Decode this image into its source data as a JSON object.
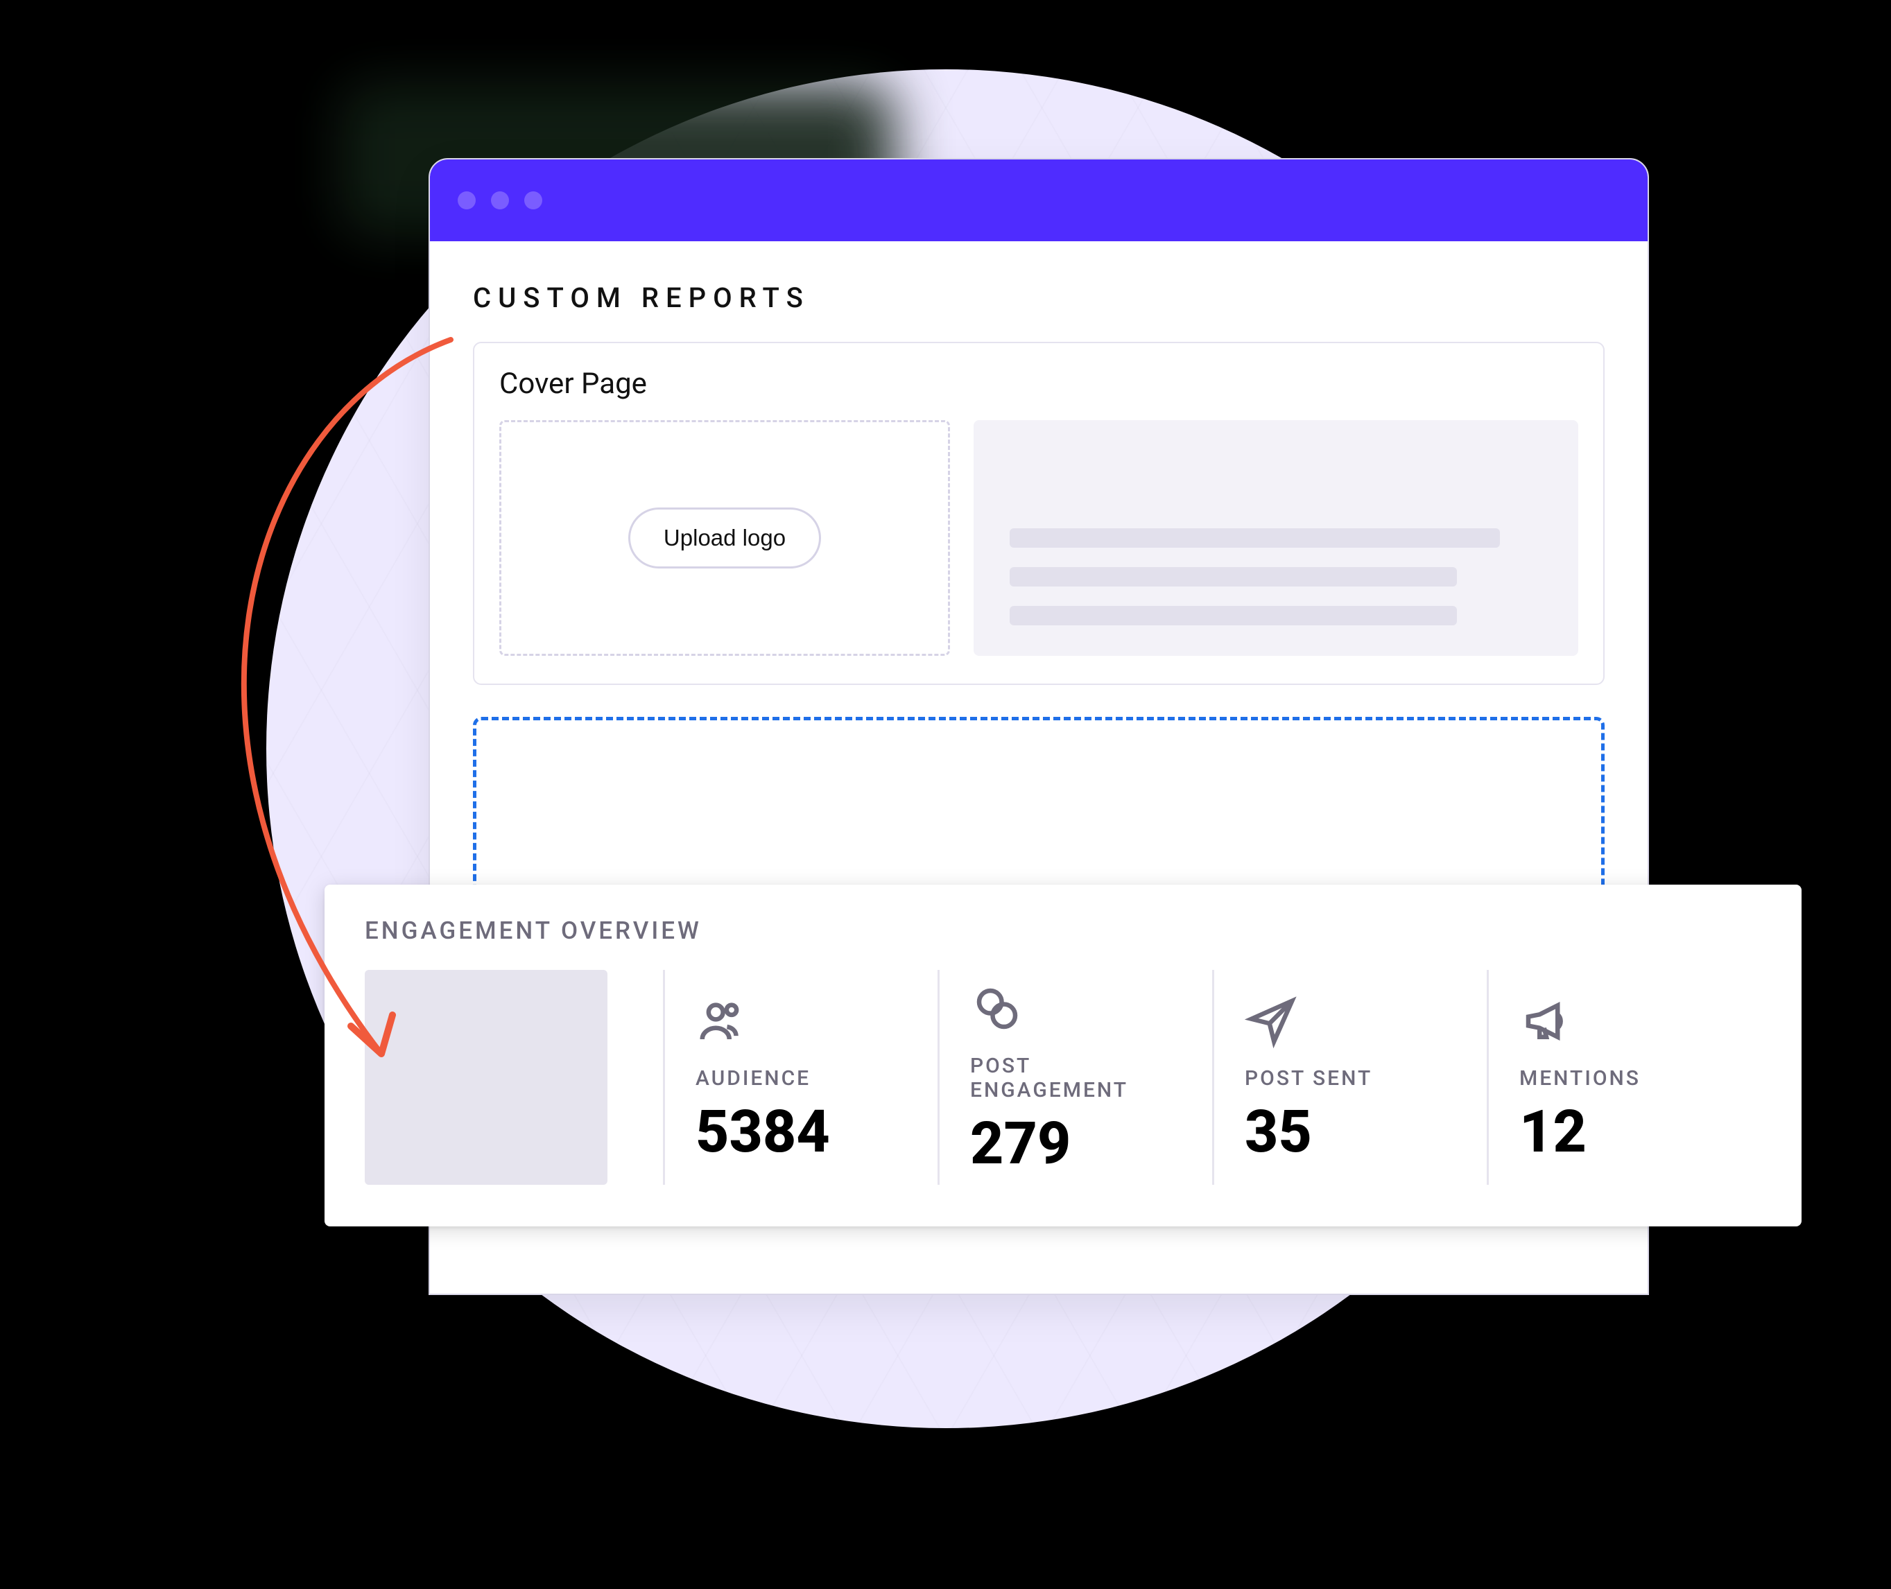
{
  "window": {
    "heading": "CUSTOM REPORTS",
    "cover_panel_title": "Cover Page",
    "upload_button_label": "Upload logo"
  },
  "engagement": {
    "title": "ENGAGEMENT OVERVIEW",
    "metrics": [
      {
        "label": "AUDIENCE",
        "value": "5384"
      },
      {
        "label": "POST ENGAGEMENT",
        "value": "279"
      },
      {
        "label": "POST SENT",
        "value": "35"
      },
      {
        "label": "MENTIONS",
        "value": "12"
      }
    ]
  },
  "colors": {
    "accent": "#4f2cff",
    "arrow": "#f05a3c",
    "dashed": "#1f6fe8"
  }
}
